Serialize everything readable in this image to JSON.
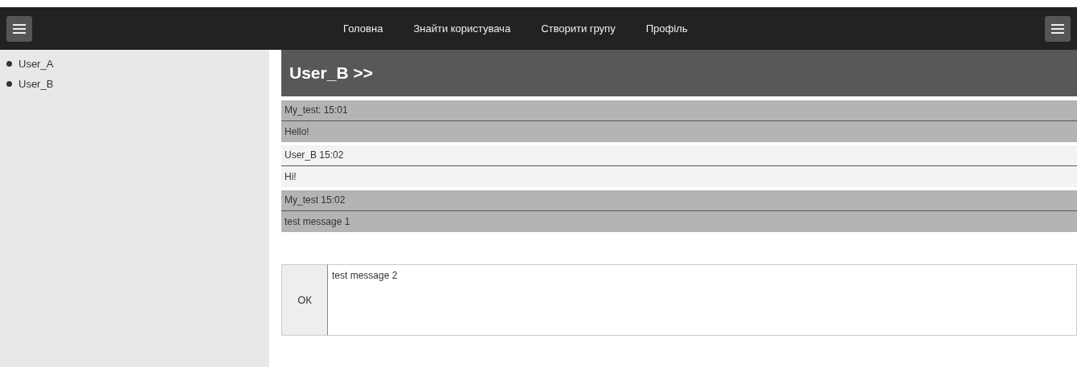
{
  "nav": {
    "items": [
      "Головна",
      "Знайти користувача",
      "Створити групу",
      "Профіль"
    ]
  },
  "sidebar": {
    "items": [
      "User_A",
      "User_B"
    ]
  },
  "chat": {
    "title": "User_B >>",
    "messages": [
      {
        "kind": "sent",
        "header": "My_test: 15:01",
        "text": "Hello!"
      },
      {
        "kind": "received",
        "header": "User_B 15:02",
        "text": "Hi!"
      },
      {
        "kind": "sent",
        "header": "My_test 15:02",
        "text": "test message 1"
      }
    ],
    "composer": {
      "button": "ОК",
      "value": "test message 2"
    }
  }
}
